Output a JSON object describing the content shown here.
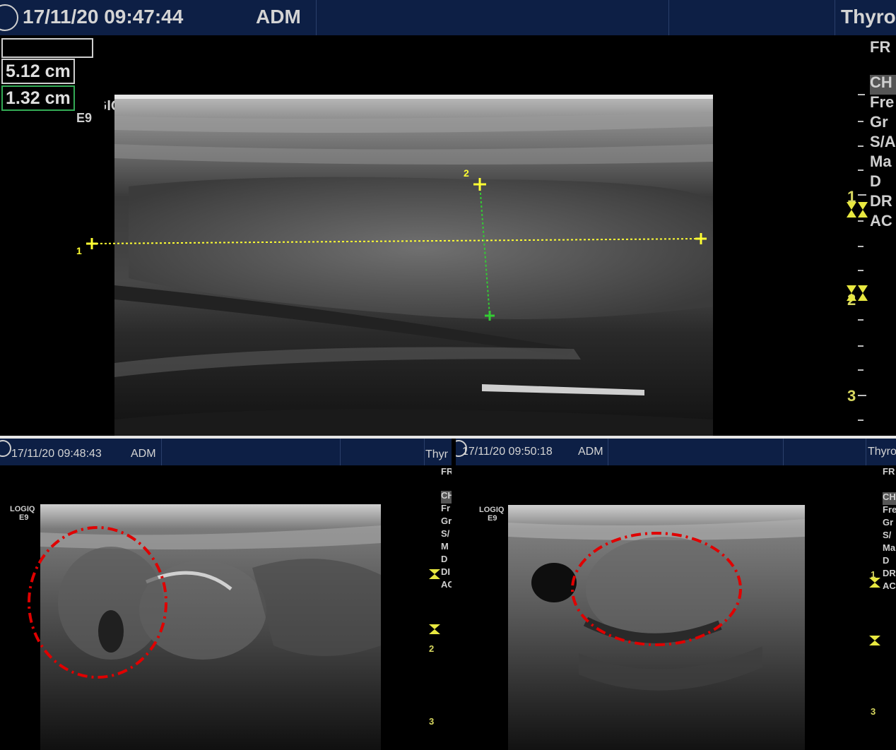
{
  "top_panel": {
    "datetime": "17/11/20 09:47:44",
    "operator": "ADM",
    "preset": "Thyro",
    "logo_text": "LOGIQ",
    "logo_sub": "E9",
    "measurements": [
      {
        "label": "1",
        "value": "5.12 cm"
      },
      {
        "label": "2",
        "value": "1.32 cm"
      }
    ],
    "params": [
      "FR",
      "CH",
      "Fre",
      "Gr",
      "S/A",
      "Ma",
      "D",
      "DR",
      "AC"
    ],
    "depth_labels": [
      "1",
      "2",
      "3"
    ],
    "cursor_labels": [
      "1",
      "2"
    ]
  },
  "bottom_left": {
    "datetime": "17/11/20 09:48:43",
    "operator": "ADM",
    "preset": "Thyr",
    "logo_text": "LOGIQ",
    "logo_sub": "E9",
    "params": [
      "FR",
      "CH",
      "Fr",
      "Gr",
      "S/",
      "M",
      "D",
      "DI",
      "AC"
    ],
    "depth_labels": [
      "2",
      "3"
    ]
  },
  "bottom_right": {
    "datetime": "17/11/20 09:50:18",
    "operator": "ADM",
    "preset": "Thyro",
    "logo_text": "LOGIQ",
    "logo_sub": "E9",
    "params": [
      "FR",
      "CH",
      "Fre",
      "Gr",
      "S/",
      "Ma",
      "D",
      "DR",
      "AC"
    ],
    "depth_labels": [
      "1",
      "3"
    ]
  },
  "colors": {
    "header_bg": "#0d1f45",
    "caliper_yellow": "#ffff33",
    "caliper_green": "#33cc33",
    "annotation_red": "#e00000",
    "focus_marker": "#e8e840"
  }
}
